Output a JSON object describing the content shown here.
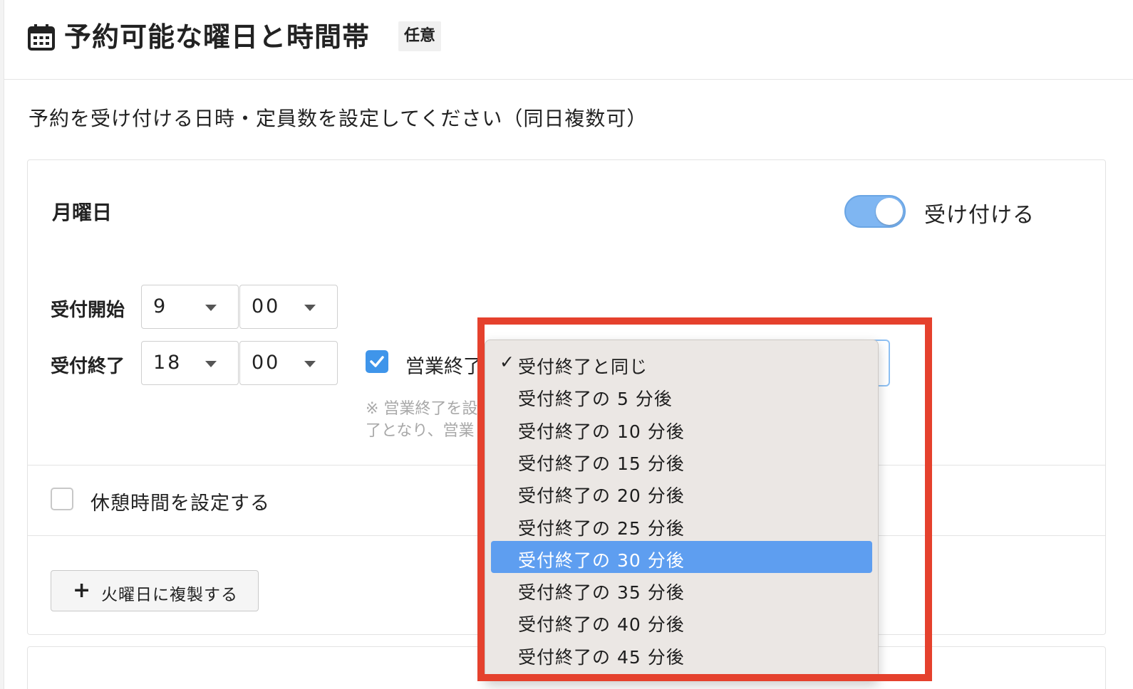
{
  "header": {
    "icon": "calendar-icon",
    "title": "予約可能な曜日と時間帯",
    "badge": "任意"
  },
  "description": "予約を受け付ける日時・定員数を設定してください（同日複数可）",
  "day": {
    "name": "月曜日",
    "toggle_on": true,
    "toggle_label": "受け付ける",
    "start": {
      "label": "受付開始",
      "hour": "9",
      "minute": "00"
    },
    "end": {
      "label": "受付終了",
      "hour": "18",
      "minute": "00"
    },
    "business_end": {
      "checked": true,
      "label": "営業終了"
    },
    "note_lines": [
      "※ 営業終了を設",
      "了となり、営業"
    ],
    "break": {
      "checked": false,
      "label": "休憩時間を設定する"
    },
    "copy_button": {
      "label": "火曜日に複製する"
    }
  },
  "dropdown": {
    "checked_index": 0,
    "selected_index": 6,
    "options": [
      "受付終了と同じ",
      "受付終了の 5 分後",
      "受付終了の 10 分後",
      "受付終了の 15 分後",
      "受付終了の 20 分後",
      "受付終了の 25 分後",
      "受付終了の 30 分後",
      "受付終了の 35 分後",
      "受付終了の 40 分後",
      "受付終了の 45 分後"
    ]
  },
  "colors": {
    "accent": "#3f95ea",
    "toggle": "#7fb6f2",
    "selected_option": "#5e9ef0",
    "highlight_frame": "#e5412d"
  }
}
